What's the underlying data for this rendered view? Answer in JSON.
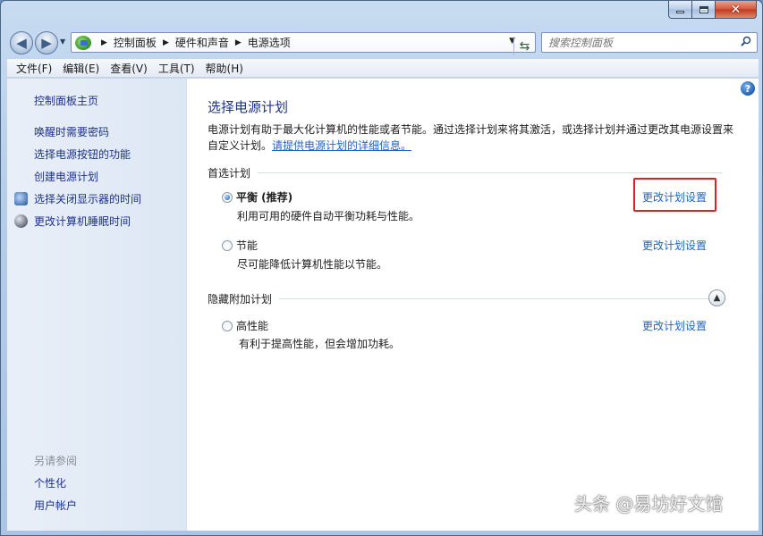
{
  "address_bar": {
    "breadcrumbs": [
      "控制面板",
      "硬件和声音",
      "电源选项"
    ]
  },
  "search": {
    "placeholder": "搜索控制面板"
  },
  "menu": [
    "文件(F)",
    "编辑(E)",
    "查看(V)",
    "工具(T)",
    "帮助(H)"
  ],
  "sidebar": {
    "links": [
      {
        "label": "控制面板主页"
      },
      {
        "label": "唤醒时需要密码"
      },
      {
        "label": "选择电源按钮的功能"
      },
      {
        "label": "创建电源计划"
      },
      {
        "label": "选择关闭显示器的时间",
        "icon": "monitor-icon"
      },
      {
        "label": "更改计算机睡眠时间",
        "icon": "moon-icon"
      }
    ],
    "see_also_title": "另请参阅",
    "see_also": [
      {
        "label": "个性化"
      },
      {
        "label": "用户帐户"
      }
    ]
  },
  "main": {
    "title": "选择电源计划",
    "description": "电源计划有助于最大化计算机的性能或者节能。通过选择计划来将其激活，或选择计划并通过更改其电源设置来自定义计划。",
    "description_link": "请提供电源计划的详细信息。",
    "preferred_heading": "首选计划",
    "hidden_heading": "隐藏附加计划",
    "plans": [
      {
        "name": "平衡 (推荐)",
        "desc": "利用可用的硬件自动平衡功耗与性能。",
        "selected": true,
        "change": "更改计划设置"
      },
      {
        "name": "节能",
        "desc": "尽可能降低计算机性能以节能。",
        "selected": false,
        "change": "更改计划设置"
      }
    ],
    "hidden_plans": [
      {
        "name": "高性能",
        "desc": "有利于提高性能，但会增加功耗。",
        "selected": false,
        "change": "更改计划设置"
      }
    ]
  },
  "watermark": "头条 @易坊好文馆",
  "colors": {
    "link": "#1e64c8",
    "title": "#1e3287",
    "highlight": "#e02020"
  }
}
